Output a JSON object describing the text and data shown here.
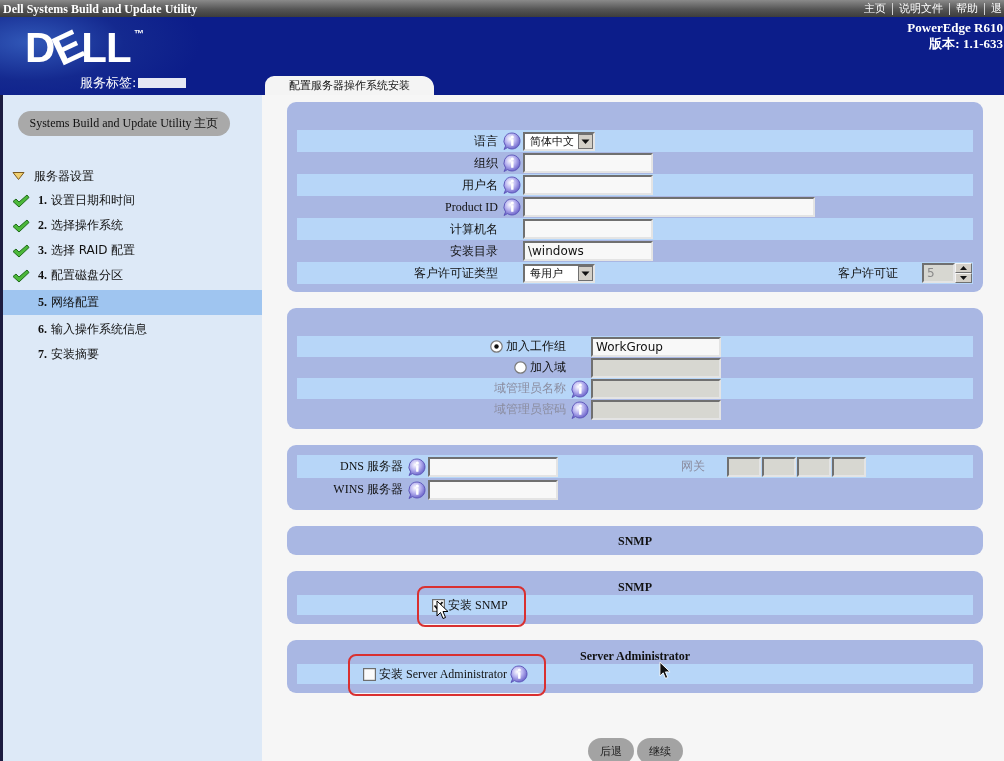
{
  "title_bar": {
    "title": "Dell Systems Build and Update Utility",
    "links": [
      "主页",
      "说明文件",
      "帮助",
      "退"
    ]
  },
  "header": {
    "logo": {
      "text": "DELL",
      "mark": "™"
    },
    "service_tag_label": "服务标签:",
    "model": "PowerEdge R610",
    "version": "版本: 1.1-633",
    "tabs": [
      {
        "label": "配置服务器操作系统安装",
        "selected": true
      }
    ]
  },
  "sidebar": {
    "home_button": "Systems Build and Update Utility 主页",
    "tree": [
      {
        "label": "服务器设置",
        "expanded": true,
        "children": [
          {
            "label": "**1.** 设置日期和时间",
            "done": true,
            "selected": false
          },
          {
            "label": "**2.** 选择操作系统",
            "done": true,
            "selected": false
          },
          {
            "label": "**3.** 选择 RAID 配置",
            "done": true,
            "selected": false
          },
          {
            "label": "**4.** 配置磁盘分区",
            "done": true,
            "selected": false
          },
          {
            "label": "**5.** 网络配置",
            "done": false,
            "selected": true
          },
          {
            "label": "**6.** 输入操作系统信息",
            "done": false,
            "selected": false
          },
          {
            "label": "**7.** 安装摘要",
            "done": false,
            "selected": false
          }
        ]
      }
    ]
  },
  "os_panel": {
    "rows": [
      {
        "kind": "select",
        "label": "语言",
        "info": true,
        "value": "简体中文"
      },
      {
        "kind": "text",
        "label": "组织",
        "info": true
      },
      {
        "kind": "text",
        "label": "用户名",
        "info": true
      },
      {
        "kind": "long_text",
        "label": "Product ID",
        "info": true
      },
      {
        "kind": "text",
        "label": "计算机名",
        "info": false
      },
      {
        "kind": "text",
        "label": "安装目录",
        "info": false,
        "value": "\\windows"
      },
      {
        "kind": "select",
        "label": "客户许可证类型",
        "info": false,
        "value": "每用户",
        "extra": {
          "label": "客户许可证",
          "value": "5",
          "disabled": true
        }
      }
    ]
  },
  "domain_panel": {
    "rows": [
      {
        "kind": "radio",
        "label": "加入工作组",
        "selected": true,
        "value": "WorkGroup",
        "disabled": false
      },
      {
        "kind": "radio",
        "label": "加入域",
        "selected": false,
        "disabled": true
      },
      {
        "kind": "text",
        "label": "域管理员名称",
        "info": true,
        "disabled": true
      },
      {
        "kind": "text",
        "label": "域管理员密码",
        "info": true,
        "disabled": true
      }
    ]
  },
  "server_panel": {
    "rows": [
      {
        "label": "DNS 服务器",
        "info": true
      },
      {
        "label": "WINS 服务器",
        "info": true
      }
    ],
    "gateway": {
      "label": "网关",
      "disabled": true
    }
  },
  "sections": [
    {
      "heading": "SNMP"
    },
    {
      "heading": "SNMP",
      "option": {
        "label": "安装 SNMP",
        "checked": true,
        "info": false,
        "highlighted": true
      }
    },
    {
      "heading": "Server Administrator",
      "option": {
        "label": "安装 Server Administrator",
        "checked": false,
        "info": true,
        "highlighted": true
      }
    }
  ],
  "buttons": [
    "后退",
    "继续"
  ]
}
